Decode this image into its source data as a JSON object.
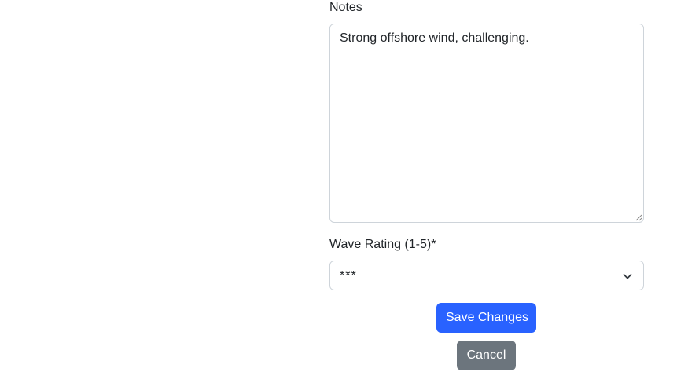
{
  "form": {
    "notes": {
      "label": "Notes",
      "value": "Strong offshore wind, challenging."
    },
    "wave_rating": {
      "label": "Wave Rating (1-5)*",
      "selected": "***"
    },
    "buttons": {
      "save_label": "Save Changes",
      "cancel_label": "Cancel"
    }
  },
  "colors": {
    "primary": "#2962ff",
    "secondary": "#6c757d",
    "border": "#ced4da",
    "text": "#212529"
  },
  "icons": {
    "select_chevron": "chevron-down-icon",
    "textarea_grip": "resize-grip-icon"
  }
}
